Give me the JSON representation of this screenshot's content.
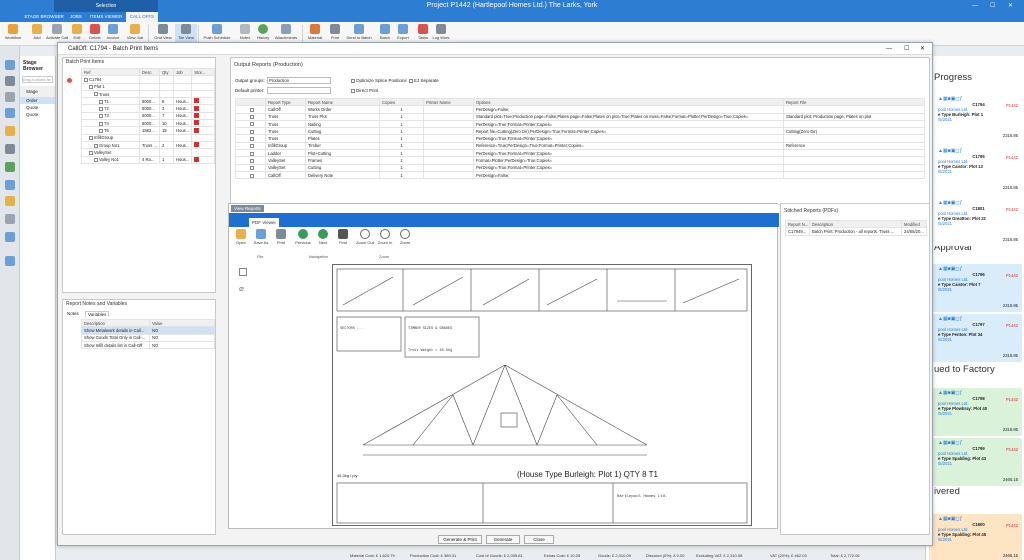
{
  "app": {
    "context_tab": "Selection",
    "title": "Project P1442 (Hartlepool Homes Ltd.) The Larks, York",
    "tabs": [
      "STAGE BROWSER",
      "JOBS",
      "ITEMS VIEWER",
      "CALL OFFS"
    ],
    "active_tab": "CALL OFFS"
  },
  "ribbon": {
    "buttons": [
      "Workflow",
      "Add",
      "Activate Call",
      "Edit",
      "Delete",
      "Invoice",
      "View Job",
      "Grid View",
      "Tile View",
      "Push Schedule",
      "Notes",
      "History",
      "Attachments",
      "Material",
      "Print",
      "Send to Batch",
      "Batch",
      "Export",
      "Tasks",
      "Log Work"
    ]
  },
  "stage_browser": {
    "title": "Stage Browser",
    "search_placeholder": "Drag a column he",
    "col": "Stage",
    "rows": [
      "Order",
      "Quote",
      "Quote"
    ]
  },
  "dialog": {
    "title": "CallOff: C1794 - Batch Print Items",
    "batch_items": {
      "title": "Batch Print Items",
      "cols": [
        "Ref",
        "Desc",
        "Qty",
        "Job",
        "Stor..."
      ],
      "rows": [
        {
          "ref": "C1794",
          "desc": "",
          "qty": "",
          "job": "",
          "stor": ""
        },
        {
          "ref": "Plot 1",
          "desc": "",
          "qty": "",
          "job": "",
          "stor": ""
        },
        {
          "ref": "Truss",
          "desc": "",
          "qty": "",
          "job": "",
          "stor": ""
        },
        {
          "ref": "T1",
          "desc": "8000...",
          "qty": "8",
          "job": "Hous...",
          "stor": ""
        },
        {
          "ref": "T2",
          "desc": "8000...",
          "qty": "3",
          "job": "Hous...",
          "stor": ""
        },
        {
          "ref": "T3",
          "desc": "5000...",
          "qty": "7",
          "job": "Hous...",
          "stor": ""
        },
        {
          "ref": "T4",
          "desc": "8000...",
          "qty": "10",
          "job": "Hous...",
          "stor": ""
        },
        {
          "ref": "T6",
          "desc": "1582...",
          "qty": "18",
          "job": "Hous...",
          "stor": ""
        },
        {
          "ref": "InfillGroup",
          "desc": "",
          "qty": "",
          "job": "",
          "stor": ""
        },
        {
          "ref": "Group No1",
          "desc": "Truss ...",
          "qty": "2",
          "job": "Hous...",
          "stor": ""
        },
        {
          "ref": "ValleySet",
          "desc": "",
          "qty": "",
          "job": "",
          "stor": ""
        },
        {
          "ref": "Valley No1",
          "desc": "4 Ra...",
          "qty": "1",
          "job": "Hous...",
          "stor": ""
        }
      ]
    },
    "report_notes": {
      "title": "Report Notes and Variables",
      "tabs": [
        "Notes",
        "Variables"
      ],
      "cols": [
        "Description",
        "Value"
      ],
      "rows": [
        {
          "desc": "Show Metalwork details in Call...",
          "val": "NO"
        },
        {
          "desc": "Show Goods Total Only in Call-...",
          "val": "NO"
        },
        {
          "desc": "Show Infill details list in Call-Off",
          "val": "NO"
        }
      ]
    },
    "output_reports": {
      "title": "Output Reports (Production)",
      "output_groups_label": "Output groups:",
      "output_groups_value": "Production",
      "default_printer_label": "Default printer:",
      "opt_splice": "Optimize Splice Positions",
      "opt_ej": "EJ Separate",
      "opt_direct": "Direct Print",
      "cols": [
        "Report Type",
        "Report Name",
        "Copies",
        "Printer Name",
        "Options",
        "Report File"
      ],
      "rows": [
        {
          "type": "CallOff",
          "name": "Works Order",
          "copies": "1",
          "printer": "",
          "options": "PerDesign=False;",
          "file": ""
        },
        {
          "type": "Truss",
          "name": "Truss Plot",
          "copies": "1",
          "printer": "",
          "options": "Standard plot=True;Production page=False;Plates page=False;Plates on plot=True;Plates on truss=False;Format=Plotter;PerDesign=True;Copies=",
          "file": "Standard plot, Production page, Plates on plot"
        },
        {
          "type": "Truss",
          "name": "Nailing",
          "copies": "1",
          "printer": "",
          "options": "PerDesign=True;Format=Printer;Copies=",
          "file": ""
        },
        {
          "type": "Truss",
          "name": "Cutting",
          "copies": "1",
          "printer": "",
          "options": "Report file=Cutting(Zero Dir);PerDesign=True;Format=Printer;Copies=",
          "file": "Cutting(Zero Dir)"
        },
        {
          "type": "Truss",
          "name": "Plates",
          "copies": "1",
          "printer": "",
          "options": "PerDesign=True;Format=Printer;Copies=",
          "file": ""
        },
        {
          "type": "InfillGroup",
          "name": "Timber",
          "copies": "1",
          "printer": "",
          "options": "Reference=True;PerDesign=True;Format=Printer;Copies=",
          "file": "Reference"
        },
        {
          "type": "Ladder",
          "name": "Plot+Cutting",
          "copies": "1",
          "printer": "",
          "options": "PerDesign=True;Format=Printer;Copies=",
          "file": ""
        },
        {
          "type": "ValleySet",
          "name": "Frames",
          "copies": "1",
          "printer": "",
          "options": "Format=Plotter;PerDesign=True;Copies=",
          "file": ""
        },
        {
          "type": "ValleySet",
          "name": "Cutting",
          "copies": "1",
          "printer": "",
          "options": "PerDesign=True;Format=Printer;Copies=",
          "file": ""
        },
        {
          "type": "CallOff",
          "name": "Delivery Note",
          "copies": "1",
          "printer": "",
          "options": "PerDesign=False;",
          "file": ""
        }
      ]
    },
    "viewer": {
      "tab": "View Reports",
      "pdf_tab": "PDF Viewer",
      "tools": [
        "Open",
        "Save As",
        "Print",
        "Previous",
        "Next",
        "Find",
        "Zoom Out",
        "Zoom In",
        "Zoom"
      ],
      "groups": [
        "File",
        "Navigation",
        "Zoom"
      ],
      "drawing_title": "(House Type Burleigh: Plot 1)  QTY 8   T1",
      "weight": "45.3kg / ply",
      "truss_weight": "Truss Weight = 45.3kg",
      "job_label": "Hartlepool Homes Ltd."
    },
    "stitched": {
      "title": "Stitched Reports (PDFs)",
      "cols": [
        "Report N...",
        "Description",
        "Modified"
      ],
      "row": {
        "name": "C17949...",
        "desc": "Batch Print: Production - all reports. Truss ...",
        "mod": "24/05/20..."
      }
    },
    "buttons": [
      "Generate & Print",
      "Generate",
      "Close"
    ]
  },
  "right_panel": {
    "filter": "Status",
    "groups": [
      "Progress",
      "Approval",
      "ued to Factory",
      "ivered"
    ],
    "cards": [
      {
        "ref": "C1794",
        "job": "P1442",
        "cust": "pool Homes Ltd.",
        "desc": "e Type Burleigh: Plot 1",
        "date": "/5/2021",
        "val": "2316.85",
        "group": 0
      },
      {
        "ref": "C1795",
        "job": "P1442",
        "cust": "pool Homes Ltd.",
        "desc": "e Type Caistor: Plot 13",
        "date": "/5/2021",
        "val": "2316.85",
        "group": 0
      },
      {
        "ref": "C1801",
        "job": "P1442",
        "cust": "pool Homes Ltd.",
        "desc": "e Type Greatton: Plot 22",
        "date": "/5/2021",
        "val": "2316.85",
        "group": 0
      },
      {
        "ref": "C1796",
        "job": "P1442",
        "cust": "pool Homes Ltd.",
        "desc": "e Type Caistor: Plot 7",
        "date": "/5/2021",
        "val": "2316.85",
        "group": 1
      },
      {
        "ref": "C1797",
        "job": "P1442",
        "cust": "pool Homes Ltd.",
        "desc": "e Type Fenton: Plot 34",
        "date": "/5/2021",
        "val": "2316.85",
        "group": 1
      },
      {
        "ref": "C1798",
        "job": "P1442",
        "cust": "pool Homes Ltd.",
        "desc": "e Type Plowbray: Plot 40",
        "date": "/5/2021",
        "val": "2316.85",
        "group": 2
      },
      {
        "ref": "C1799",
        "job": "P1442",
        "cust": "pool Homes Ltd.",
        "desc": "e Type Spalding: Plot 43",
        "date": "/5/2021",
        "val": "2465.15",
        "group": 2
      },
      {
        "ref": "C1800",
        "job": "P1442",
        "cust": "pool Homes Ltd.",
        "desc": "e Type Spalding: Plot 45",
        "date": "/5/2021",
        "val": "2465.15",
        "group": 3
      }
    ]
  },
  "statusbar": {
    "items": [
      "Material Cost: £ 1,620.79",
      "Production Cost: £ 389.31",
      "Cost of Goods: £ 2,005.61",
      "Extras Cost: £ 10.25",
      "Goods: £ 2,310.09",
      "Discount (0%): £ 0.00",
      "Excluding VAT: £ 2,310.08",
      "VAT (20%): £ 462.03",
      "Total: £ 2,772.06"
    ]
  }
}
